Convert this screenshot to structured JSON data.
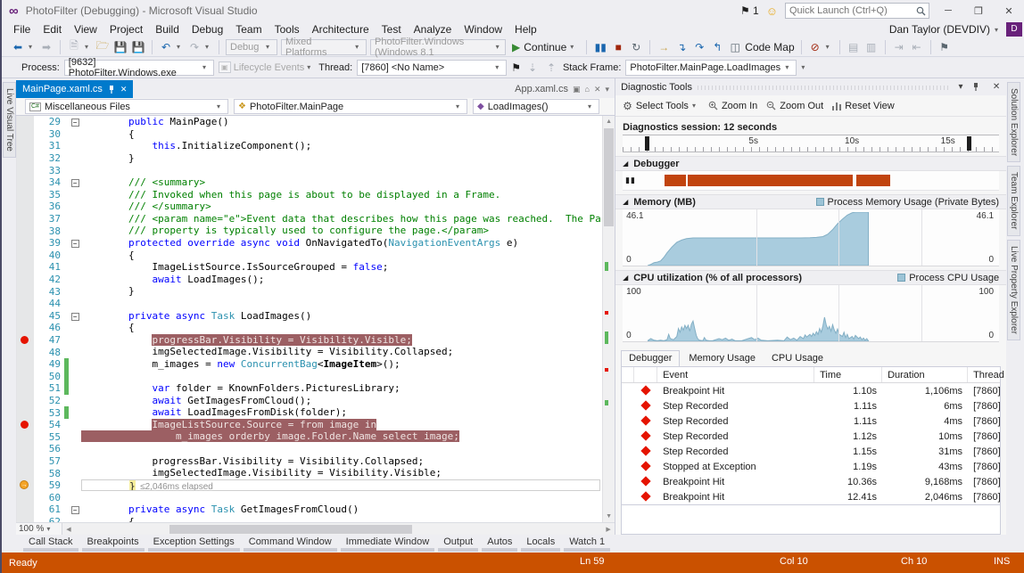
{
  "title_bar": {
    "title": "PhotoFilter (Debugging) - Microsoft Visual Studio",
    "notification_count": "1",
    "quick_launch_placeholder": "Quick Launch (Ctrl+Q)"
  },
  "menu": {
    "items": [
      "File",
      "Edit",
      "View",
      "Project",
      "Build",
      "Debug",
      "Team",
      "Tools",
      "Architecture",
      "Test",
      "Analyze",
      "Window",
      "Help"
    ],
    "user": "Dan Taylor (DEVDIV)",
    "avatar_initial": "D"
  },
  "toolbar": {
    "config": "Debug",
    "platform": "Mixed Platforms",
    "startup": "PhotoFilter.Windows (Windows 8.1",
    "continue_label": "Continue",
    "code_map_label": "Code Map"
  },
  "debug_bar": {
    "process_label": "Process:",
    "process_value": "[9632] PhotoFilter.Windows.exe",
    "lifecycle_label": "Lifecycle Events",
    "thread_label": "Thread:",
    "thread_value": "[7860] <No Name>",
    "stack_frame_label": "Stack Frame:",
    "stack_frame_value": "PhotoFilter.MainPage.LoadImages"
  },
  "editor": {
    "tabs": {
      "active": "MainPage.xaml.cs",
      "preview": "App.xaml.cs"
    },
    "nav": {
      "project": "Miscellaneous Files",
      "type": "PhotoFilter.MainPage",
      "member": "LoadImages()"
    },
    "zoom": "100 %",
    "code": {
      "lines": [
        {
          "n": 29,
          "fold": true,
          "parts": [
            [
              "kw",
              "        public "
            ],
            [
              "tx",
              "MainPage()"
            ]
          ]
        },
        {
          "n": 30,
          "parts": [
            [
              "tx",
              "        {"
            ]
          ]
        },
        {
          "n": 31,
          "parts": [
            [
              "tx",
              "            "
            ],
            [
              "kw",
              "this"
            ],
            [
              "tx",
              ".InitializeComponent();"
            ]
          ]
        },
        {
          "n": 32,
          "parts": [
            [
              "tx",
              "        }"
            ]
          ]
        },
        {
          "n": 33,
          "parts": []
        },
        {
          "n": 34,
          "fold": true,
          "parts": [
            [
              "cm",
              "        /// <summary>"
            ]
          ]
        },
        {
          "n": 35,
          "parts": [
            [
              "cm",
              "        /// Invoked when this page is about to be displayed in a Frame."
            ]
          ]
        },
        {
          "n": 36,
          "parts": [
            [
              "cm",
              "        /// </summary>"
            ]
          ]
        },
        {
          "n": 37,
          "parts": [
            [
              "cm",
              "        /// <param name=\"e\">Event data that describes how this page was reached.  The Parameter"
            ]
          ]
        },
        {
          "n": 38,
          "parts": [
            [
              "cm",
              "        /// property is typically used to configure the page.</param>"
            ]
          ]
        },
        {
          "n": 39,
          "fold": true,
          "parts": [
            [
              "kw",
              "        protected override async void "
            ],
            [
              "tx",
              "OnNavigatedTo("
            ],
            [
              "ty",
              "NavigationEventArgs"
            ],
            [
              "tx",
              " e)"
            ]
          ]
        },
        {
          "n": 40,
          "parts": [
            [
              "tx",
              "        {"
            ]
          ]
        },
        {
          "n": 41,
          "parts": [
            [
              "tx",
              "            ImageListSource.IsSourceGrouped = "
            ],
            [
              "kw",
              "false"
            ],
            [
              "tx",
              ";"
            ]
          ]
        },
        {
          "n": 42,
          "parts": [
            [
              "tx",
              "            "
            ],
            [
              "kw",
              "await"
            ],
            [
              "tx",
              " LoadImages();"
            ]
          ]
        },
        {
          "n": 43,
          "parts": [
            [
              "tx",
              "        }"
            ]
          ]
        },
        {
          "n": 44,
          "parts": []
        },
        {
          "n": 45,
          "fold": true,
          "parts": [
            [
              "kw",
              "        private async "
            ],
            [
              "ty",
              "Task"
            ],
            [
              "tx",
              " LoadImages()"
            ]
          ]
        },
        {
          "n": 46,
          "parts": [
            [
              "tx",
              "        {"
            ]
          ]
        },
        {
          "n": 47,
          "bp": "red",
          "parts": [
            [
              "tx",
              "            "
            ],
            [
              "hl",
              "progressBar.Visibility = Visibility.Visible;"
            ]
          ]
        },
        {
          "n": 48,
          "parts": [
            [
              "tx",
              "            imgSelectedImage.Visibility = Visibility.Collapsed;"
            ]
          ]
        },
        {
          "n": 49,
          "bar": true,
          "parts": [
            [
              "tx",
              "            m_images = "
            ],
            [
              "kw",
              "new"
            ],
            [
              "tx",
              " "
            ],
            [
              "ty",
              "ConcurrentBag"
            ],
            [
              "tx",
              "<"
            ],
            [
              "b",
              "ImageItem"
            ],
            [
              "tx",
              ">();"
            ]
          ]
        },
        {
          "n": 50,
          "bar": true,
          "parts": []
        },
        {
          "n": 51,
          "bar": true,
          "parts": [
            [
              "tx",
              "            "
            ],
            [
              "kw",
              "var"
            ],
            [
              "tx",
              " folder = KnownFolders.PicturesLibrary;"
            ]
          ]
        },
        {
          "n": 52,
          "parts": [
            [
              "tx",
              "            "
            ],
            [
              "kw",
              "await"
            ],
            [
              "tx",
              " GetImagesFromCloud();"
            ]
          ]
        },
        {
          "n": 53,
          "bar": true,
          "parts": [
            [
              "tx",
              "            "
            ],
            [
              "kw",
              "await"
            ],
            [
              "tx",
              " LoadImagesFromDisk(folder);"
            ]
          ]
        },
        {
          "n": 54,
          "bp": "red",
          "parts": [
            [
              "tx",
              "            "
            ],
            [
              "hl",
              "ImageListSource.Source = from image in"
            ]
          ]
        },
        {
          "n": 55,
          "parts": [
            [
              "hl",
              "                m_images orderby image.Folder.Name select image;"
            ]
          ]
        },
        {
          "n": 56,
          "parts": []
        },
        {
          "n": 57,
          "parts": [
            [
              "tx",
              "            progressBar.Visibility = Visibility.Collapsed;"
            ]
          ]
        },
        {
          "n": 58,
          "parts": [
            [
              "tx",
              "            imgSelectedImage.Visibility = Visibility.Visible;"
            ]
          ]
        },
        {
          "n": 59,
          "bp": "current",
          "perf": "≤2,046ms elapsed",
          "parts": [
            [
              "tx",
              "        "
            ],
            [
              "brace",
              "}"
            ]
          ]
        },
        {
          "n": 60,
          "parts": []
        },
        {
          "n": 61,
          "fold": true,
          "parts": [
            [
              "kw",
              "        private async "
            ],
            [
              "ty",
              "Task"
            ],
            [
              "tx",
              " GetImagesFromCloud()"
            ]
          ]
        },
        {
          "n": 62,
          "parts": [
            [
              "tx",
              "        {"
            ]
          ]
        }
      ]
    }
  },
  "diagnostics": {
    "title": "Diagnostic Tools",
    "toolbar": {
      "select_tools": "Select Tools",
      "zoom_in": "Zoom In",
      "zoom_out": "Zoom Out",
      "reset_view": "Reset View"
    },
    "session_label": "Diagnostics session: 12 seconds",
    "timeline": {
      "labels": [
        {
          "t": "5s",
          "x": 0.335
        },
        {
          "t": "10s",
          "x": 0.59
        },
        {
          "t": "15s",
          "x": 0.845
        }
      ],
      "handles": [
        0.06,
        0.915
      ]
    },
    "debugger_section": {
      "title": "Debugger",
      "segments": [
        [
          0.072,
          0.132
        ],
        [
          0.137,
          0.595
        ],
        [
          0.603,
          0.697
        ]
      ]
    },
    "memory": {
      "title": "Memory (MB)",
      "legend": "Process Memory Usage (Private Bytes)",
      "max_label": "46.1",
      "min_label": "0",
      "max": 46.1,
      "points": [
        [
          0,
          0
        ],
        [
          0.01,
          1
        ],
        [
          0.02,
          2.5
        ],
        [
          0.03,
          3
        ],
        [
          0.04,
          4
        ],
        [
          0.05,
          7
        ],
        [
          0.06,
          11
        ],
        [
          0.075,
          16
        ],
        [
          0.09,
          20
        ],
        [
          0.105,
          22
        ],
        [
          0.12,
          23.2
        ],
        [
          0.14,
          23.8
        ],
        [
          0.2,
          23.8
        ],
        [
          0.3,
          23.8
        ],
        [
          0.4,
          23.8
        ],
        [
          0.47,
          23.8
        ],
        [
          0.5,
          24
        ],
        [
          0.52,
          24.3
        ],
        [
          0.54,
          25
        ],
        [
          0.555,
          27
        ],
        [
          0.57,
          31
        ],
        [
          0.585,
          36
        ],
        [
          0.6,
          40
        ],
        [
          0.615,
          43.5
        ],
        [
          0.63,
          45.5
        ],
        [
          0.64,
          46.1
        ],
        [
          0.68,
          46.1
        ]
      ]
    },
    "cpu": {
      "title": "CPU utilization (% of all processors)",
      "legend": "Process CPU Usage",
      "max_label": "100",
      "min_label": "0",
      "max": 100,
      "points": [
        [
          0,
          1
        ],
        [
          0.01,
          5
        ],
        [
          0.02,
          2
        ],
        [
          0.03,
          1
        ],
        [
          0.04,
          2
        ],
        [
          0.05,
          1
        ],
        [
          0.06,
          3
        ],
        [
          0.065,
          13
        ],
        [
          0.07,
          5
        ],
        [
          0.08,
          3
        ],
        [
          0.09,
          9
        ],
        [
          0.095,
          24
        ],
        [
          0.1,
          17
        ],
        [
          0.105,
          27
        ],
        [
          0.11,
          21
        ],
        [
          0.115,
          30
        ],
        [
          0.12,
          24
        ],
        [
          0.125,
          30
        ],
        [
          0.13,
          19
        ],
        [
          0.135,
          32
        ],
        [
          0.14,
          38
        ],
        [
          0.145,
          24
        ],
        [
          0.15,
          11
        ],
        [
          0.155,
          4
        ],
        [
          0.16,
          2
        ],
        [
          0.17,
          1
        ],
        [
          0.175,
          7
        ],
        [
          0.18,
          2
        ],
        [
          0.19,
          1
        ],
        [
          0.2,
          1
        ],
        [
          0.22,
          5
        ],
        [
          0.23,
          3
        ],
        [
          0.24,
          6
        ],
        [
          0.25,
          2
        ],
        [
          0.26,
          4
        ],
        [
          0.27,
          1
        ],
        [
          0.29,
          1
        ],
        [
          0.31,
          5
        ],
        [
          0.32,
          7
        ],
        [
          0.33,
          3
        ],
        [
          0.34,
          6
        ],
        [
          0.35,
          2
        ],
        [
          0.37,
          1
        ],
        [
          0.4,
          2
        ],
        [
          0.42,
          1
        ],
        [
          0.43,
          8
        ],
        [
          0.44,
          3
        ],
        [
          0.45,
          6
        ],
        [
          0.46,
          2
        ],
        [
          0.47,
          9
        ],
        [
          0.48,
          5
        ],
        [
          0.485,
          12
        ],
        [
          0.49,
          8
        ],
        [
          0.5,
          13
        ],
        [
          0.505,
          9
        ],
        [
          0.51,
          15
        ],
        [
          0.515,
          11
        ],
        [
          0.52,
          18
        ],
        [
          0.525,
          13
        ],
        [
          0.53,
          24
        ],
        [
          0.535,
          17
        ],
        [
          0.54,
          29
        ],
        [
          0.545,
          45
        ],
        [
          0.55,
          31
        ],
        [
          0.555,
          23
        ],
        [
          0.56,
          28
        ],
        [
          0.565,
          19
        ],
        [
          0.57,
          31
        ],
        [
          0.575,
          21
        ],
        [
          0.58,
          15
        ],
        [
          0.585,
          23
        ],
        [
          0.59,
          13
        ],
        [
          0.6,
          9
        ],
        [
          0.605,
          17
        ],
        [
          0.61,
          7
        ],
        [
          0.615,
          13
        ],
        [
          0.62,
          5
        ],
        [
          0.63,
          9
        ],
        [
          0.635,
          4
        ],
        [
          0.64,
          11
        ],
        [
          0.65,
          5
        ],
        [
          0.655,
          8
        ],
        [
          0.66,
          3
        ],
        [
          0.665,
          6
        ],
        [
          0.67,
          2
        ],
        [
          0.675,
          5
        ],
        [
          0.68,
          1
        ]
      ]
    },
    "events": {
      "tabs": [
        "Debugger",
        "Memory Usage",
        "CPU Usage"
      ],
      "active_tab": "Debugger",
      "columns": [
        "Event",
        "Time",
        "Duration",
        "Thread"
      ],
      "rows": [
        {
          "event": "Breakpoint Hit",
          "time": "1.10s",
          "duration": "1,106ms",
          "thread": "[7860]"
        },
        {
          "event": "Step Recorded",
          "time": "1.11s",
          "duration": "6ms",
          "thread": "[7860]"
        },
        {
          "event": "Step Recorded",
          "time": "1.11s",
          "duration": "4ms",
          "thread": "[7860]"
        },
        {
          "event": "Step Recorded",
          "time": "1.12s",
          "duration": "10ms",
          "thread": "[7860]"
        },
        {
          "event": "Step Recorded",
          "time": "1.15s",
          "duration": "31ms",
          "thread": "[7860]"
        },
        {
          "event": "Stopped at Exception",
          "time": "1.19s",
          "duration": "43ms",
          "thread": "[7860]"
        },
        {
          "event": "Breakpoint Hit",
          "time": "10.36s",
          "duration": "9,168ms",
          "thread": "[7860]"
        },
        {
          "event": "Breakpoint Hit",
          "time": "12.41s",
          "duration": "2,046ms",
          "thread": "[7860]"
        }
      ]
    }
  },
  "side_tabs": {
    "left": [
      "Live Visual Tree"
    ],
    "right": [
      "Solution Explorer",
      "Team Explorer",
      "Live Property Explorer"
    ]
  },
  "bottom_tabs": [
    "Call Stack",
    "Breakpoints",
    "Exception Settings",
    "Command Window",
    "Immediate Window",
    "Output",
    "Autos",
    "Locals",
    "Watch 1"
  ],
  "status_bar": {
    "ready": "Ready",
    "line": "Ln 59",
    "col": "Col 10",
    "ch": "Ch 10",
    "mode": "INS"
  },
  "colors": {
    "accent": "#007ACC",
    "debug_status": "#CA5100",
    "highlight": "#9C5F63",
    "chart_fill": "#9CC3D6",
    "breakpoint": "#E51400"
  }
}
